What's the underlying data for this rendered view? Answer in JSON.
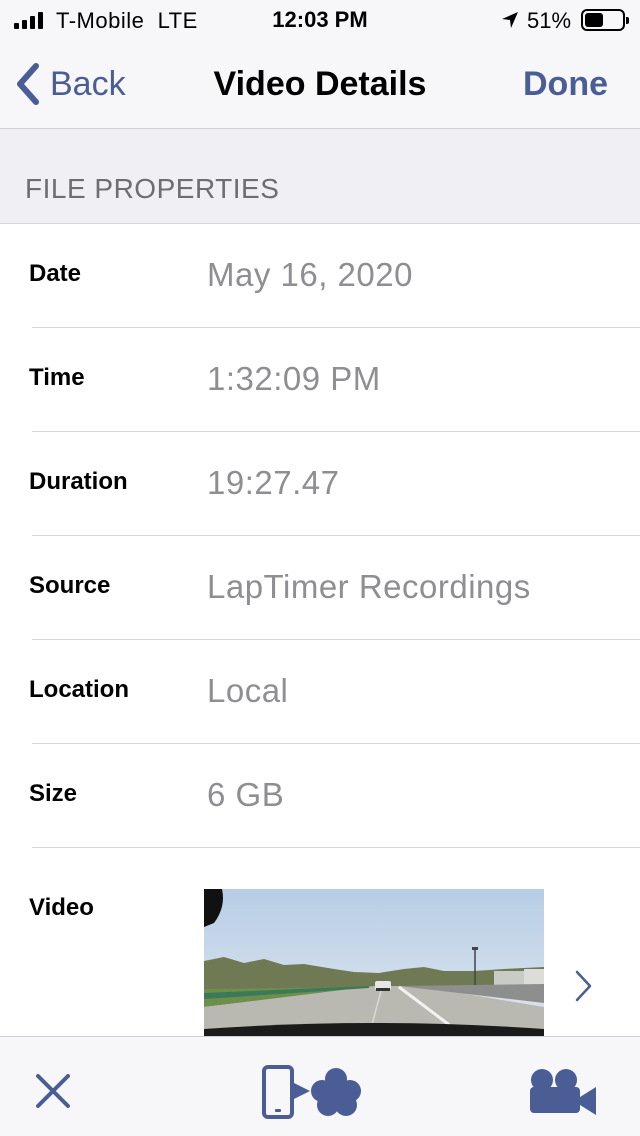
{
  "status_bar": {
    "carrier": "T-Mobile  LTE",
    "time": "12:03 PM",
    "battery_percent": "51%",
    "battery_level": 0.51,
    "icons": [
      "signal-icon",
      "location-arrow-icon",
      "battery-icon"
    ]
  },
  "nav": {
    "back_label": "Back",
    "title": "Video Details",
    "done_label": "Done",
    "accent_color": "#4a5d94"
  },
  "section": {
    "header": "FILE PROPERTIES"
  },
  "properties": [
    {
      "label": "Date",
      "value": "May 16, 2020"
    },
    {
      "label": "Time",
      "value": "1:32:09 PM"
    },
    {
      "label": "Duration",
      "value": "19:27.47"
    },
    {
      "label": "Source",
      "value": "LapTimer Recordings"
    },
    {
      "label": "Location",
      "value": "Local"
    },
    {
      "label": "Size",
      "value": "6 GB"
    }
  ],
  "video": {
    "label": "Video",
    "thumbnail_icon": "video-thumbnail",
    "disclosure_icon": "chevron-right-icon"
  },
  "toolbar": {
    "icons": [
      "close-icon",
      "phone-to-cloud-icon",
      "video-camera-icon"
    ]
  }
}
